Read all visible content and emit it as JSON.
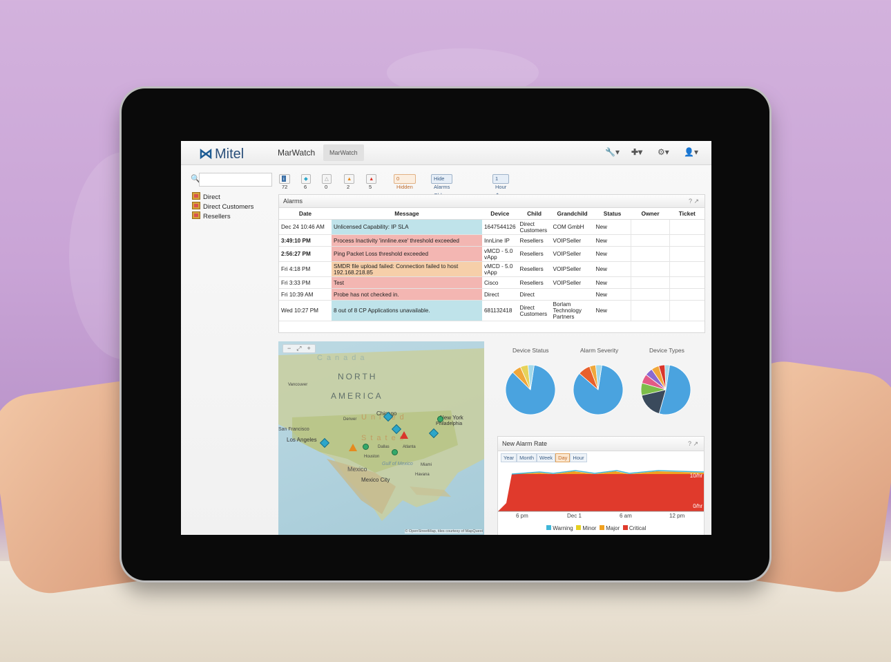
{
  "app": {
    "logo_text": "Mitel",
    "title": "MarWatch",
    "tab": "MarWatch",
    "toolbar_icons": [
      "wrench-icon",
      "plus-icon",
      "gear-icon",
      "user-icon"
    ]
  },
  "sidebar": {
    "search_placeholder": "",
    "items": [
      {
        "label": "Direct"
      },
      {
        "label": "Direct Customers"
      },
      {
        "label": "Resellers"
      }
    ]
  },
  "alarm_filters": {
    "badges": [
      {
        "label": "72",
        "icon": "info-icon",
        "color": "#3a6ea5"
      },
      {
        "label": "6",
        "icon": "warning-icon",
        "color": "#2ca6c9"
      },
      {
        "label": "0",
        "icon": "minor-icon",
        "color": "#e0c12a"
      },
      {
        "label": "2",
        "icon": "major-icon",
        "color": "#e58a1f"
      },
      {
        "label": "5",
        "icon": "critical-icon",
        "color": "#d9362b"
      }
    ],
    "hidden": "0 Hidden",
    "hide_older_label": "Hide Alarms Older Than",
    "hide_older_value": "1 Hour"
  },
  "alarms": {
    "title": "Alarms",
    "columns": [
      "Date",
      "Message",
      "Device",
      "Child",
      "Grandchild",
      "Status",
      "Owner",
      "Ticket"
    ],
    "rows": [
      {
        "date": "Dec 24 10:46 AM",
        "message": "Unlicensed Capability: IP SLA",
        "device": "1647544126",
        "child": "Direct Customers",
        "grandchild": "COM GmbH",
        "status": "New",
        "severity": "#bfe3ea",
        "bold": false
      },
      {
        "date": "3:49:10 PM",
        "message": "Process Inactivity 'innline.exe' threshold exceeded",
        "device": "InnLine IP",
        "child": "Resellers",
        "grandchild": "VOIPSeller",
        "status": "New",
        "severity": "#f3b6b2",
        "bold": true
      },
      {
        "date": "2:56:27 PM",
        "message": "Ping Packet Loss threshold exceeded",
        "device": "vMCD - 5.0 vApp",
        "child": "Resellers",
        "grandchild": "VOIPSeller",
        "status": "New",
        "severity": "#f3b6b2",
        "bold": true
      },
      {
        "date": "Fri 4:18 PM",
        "message": "SMDR file upload failed: Connection failed to host 192.168.218.85",
        "device": "vMCD - 5.0 vApp",
        "child": "Resellers",
        "grandchild": "VOIPSeller",
        "status": "New",
        "severity": "#f6cfa9",
        "bold": false
      },
      {
        "date": "Fri 3:33 PM",
        "message": "Test",
        "device": "Cisco",
        "child": "Resellers",
        "grandchild": "VOIPSeller",
        "status": "New",
        "severity": "#f3b6b2",
        "bold": false
      },
      {
        "date": "Fri 10:39 AM",
        "message": "Probe has not checked in.",
        "device": "Direct",
        "child": "Direct",
        "grandchild": "",
        "status": "New",
        "severity": "#f3b6b2",
        "bold": false
      },
      {
        "date": "Wed 10:27 PM",
        "message": "8 out of 8 CP Applications unavailable.",
        "device": "681132418",
        "child": "Direct Customers",
        "grandchild": "Borlam Technology Partners",
        "status": "New",
        "severity": "#bfe3ea",
        "bold": false
      }
    ]
  },
  "map": {
    "zoom_controls": [
      "−",
      "⤢",
      "+"
    ],
    "labels": [
      "Canada",
      "NORTH",
      "AMERICA",
      "United",
      "States",
      "Mexico",
      "Gulf of Mexico",
      "Los Angeles",
      "San Francisco",
      "Chicago",
      "New York",
      "Philadelphia",
      "Houston",
      "Miami",
      "Havana",
      "Mexico City",
      "Vancouver",
      "Denver",
      "Dallas",
      "Atlanta"
    ],
    "attribution": "© OpenStreetMap, tiles courtesy of MapQuest"
  },
  "pies": {
    "device_status": {
      "title": "Device Status",
      "slices": [
        {
          "value": 85,
          "color": "#4aa3df"
        },
        {
          "value": 6,
          "color": "#f0a73a"
        },
        {
          "value": 5,
          "color": "#e6d35a"
        },
        {
          "value": 4,
          "color": "#a3d9ea"
        }
      ]
    },
    "alarm_severity": {
      "title": "Alarm Severity",
      "slices": [
        {
          "value": 84,
          "color": "#4aa3df"
        },
        {
          "value": 8,
          "color": "#e8602c"
        },
        {
          "value": 4,
          "color": "#f0a73a"
        },
        {
          "value": 4,
          "color": "#a3d9ea"
        }
      ]
    },
    "device_types": {
      "title": "Device Types",
      "slices": [
        {
          "value": 52,
          "color": "#4aa3df"
        },
        {
          "value": 17,
          "color": "#3a4a5c"
        },
        {
          "value": 8,
          "color": "#7dbd4a"
        },
        {
          "value": 6,
          "color": "#e35b86"
        },
        {
          "value": 5,
          "color": "#8a6ad0"
        },
        {
          "value": 5,
          "color": "#f0a73a"
        },
        {
          "value": 4,
          "color": "#d9362b"
        },
        {
          "value": 3,
          "color": "#a3d9ea"
        }
      ]
    }
  },
  "alarm_rate": {
    "title": "New Alarm Rate",
    "ranges": [
      "Year",
      "Month",
      "Week",
      "Day",
      "Hour"
    ],
    "active_range": "Day",
    "chart_data": {
      "type": "area",
      "x_ticks": [
        "6 pm",
        "Dec 1",
        "6 am",
        "12 pm"
      ],
      "y_ticks": [
        "10/hr",
        "0/hr"
      ],
      "series": [
        {
          "name": "Warning",
          "color": "#3fb6d8"
        },
        {
          "name": "Minor",
          "color": "#e6d020"
        },
        {
          "name": "Major",
          "color": "#f0a020"
        },
        {
          "name": "Critical",
          "color": "#e03a2c"
        }
      ]
    }
  }
}
